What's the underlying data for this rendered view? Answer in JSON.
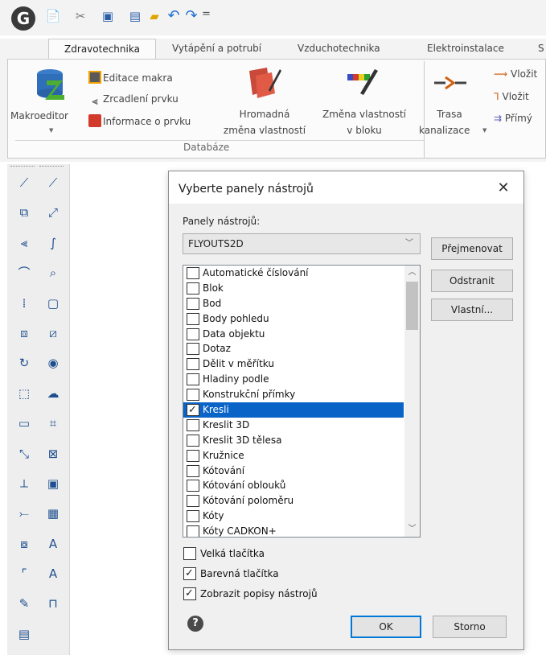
{
  "quick_access": {
    "logo_letter": "G",
    "icons": [
      "new-file-icon",
      "magic-tools-icon",
      "save-icon",
      "save-as-icon",
      "open-folder-icon",
      "undo-icon",
      "redo-icon"
    ],
    "menu_glyph": "="
  },
  "ribbon": {
    "tabs": [
      {
        "label": "Zdravotechnika",
        "active": true
      },
      {
        "label": "Vytápění a potrubí",
        "active": false
      },
      {
        "label": "Vzduchotechnika",
        "active": false
      },
      {
        "label": "Elektroinstalace",
        "active": false
      },
      {
        "label": "S",
        "active": false
      }
    ],
    "makroeditor_label": "Makroeditor",
    "edit_macro_label": "Editace makra",
    "mirror_label": "Zrcadlení prvku",
    "element_info_label": "Informace o prvku",
    "bulk_change_label_1": "Hromadná",
    "bulk_change_label_2": "změna vlastností",
    "block_change_label_1": "Změna vlastností",
    "block_change_label_2": "v bloku",
    "group_label": "Databáze",
    "route_label_1": "Trasa",
    "route_label_2": "kanalizace",
    "insert_label_1": "Vložit",
    "insert_label_2": "Vložit",
    "straight_label": "Přímý"
  },
  "dialog": {
    "title": "Vyberte panely nástrojů",
    "close_glyph": "✕",
    "panels_label": "Panely nástrojů:",
    "selected_panel": "FLYOUTS2D",
    "rename_button": "Přejmenovat",
    "remove_button": "Odstranit",
    "custom_button": "Vlastní...",
    "items": [
      {
        "label": "Automatické číslování",
        "checked": false,
        "selected": false
      },
      {
        "label": "Blok",
        "checked": false,
        "selected": false
      },
      {
        "label": "Bod",
        "checked": false,
        "selected": false
      },
      {
        "label": "Body pohledu",
        "checked": false,
        "selected": false
      },
      {
        "label": "Data objektu",
        "checked": false,
        "selected": false
      },
      {
        "label": "Dotaz",
        "checked": false,
        "selected": false
      },
      {
        "label": "Dělit v měřítku",
        "checked": false,
        "selected": false
      },
      {
        "label": "Hladiny podle",
        "checked": false,
        "selected": false
      },
      {
        "label": "Konstrukční přímky",
        "checked": false,
        "selected": false
      },
      {
        "label": "Kresli",
        "checked": true,
        "selected": true
      },
      {
        "label": "Kreslit 3D",
        "checked": false,
        "selected": false
      },
      {
        "label": "Kreslit 3D tělesa",
        "checked": false,
        "selected": false
      },
      {
        "label": "Kružnice",
        "checked": false,
        "selected": false
      },
      {
        "label": "Kótování",
        "checked": false,
        "selected": false
      },
      {
        "label": "Kótování oblouků",
        "checked": false,
        "selected": false
      },
      {
        "label": "Kótování poloměru",
        "checked": false,
        "selected": false
      },
      {
        "label": "Kóty",
        "checked": false,
        "selected": false
      },
      {
        "label": "Kóty CADKON+",
        "checked": false,
        "selected": false
      }
    ],
    "large_buttons_label": "Velká tlačítka",
    "large_buttons_checked": false,
    "color_buttons_label": "Barevná tlačítka",
    "color_buttons_checked": true,
    "show_tooltips_label": "Zobrazit popisy nástrojů",
    "show_tooltips_checked": true,
    "help_glyph": "?",
    "ok_button": "OK",
    "cancel_button": "Storno"
  },
  "toolbar": {
    "col1_icons": [
      "line-icon",
      "move-icon",
      "mirror-icon",
      "fillet-icon",
      "array-icon",
      "copy-icon",
      "rotate-icon",
      "rectangle-icon",
      "region-icon",
      "polyline-icon",
      "trim-icon",
      "extend-icon",
      "insert-icon",
      "arc-icon",
      "erase-icon",
      "layer-icon"
    ],
    "col2_icons": [
      "line-draw-icon",
      "dimension-icon",
      "spline-icon",
      "zoom-icon",
      "rectangle-draw-icon",
      "hatch-icon",
      "circle-icon",
      "cloud-icon",
      "zoom-window-icon",
      "zoom-extents-icon",
      "frame-icon",
      "color-grid-icon",
      "text-icon",
      "text-color-icon",
      "beam-icon"
    ],
    "col1_glyphs": [
      "⟋",
      "⧉",
      "⫷",
      "⌒",
      "⁞",
      "⧈",
      "↻",
      "⬚",
      "▭",
      "⤡",
      "⟂",
      "⤚",
      "⧇",
      "⌜",
      "✎",
      "▤"
    ],
    "col2_glyphs": [
      "⟋",
      "⤢",
      "∫",
      "⌕",
      "▢",
      "⧄",
      "◉",
      "☁",
      "⌗",
      "⊠",
      "▣",
      "▦",
      "A",
      "A",
      "⊓"
    ]
  }
}
